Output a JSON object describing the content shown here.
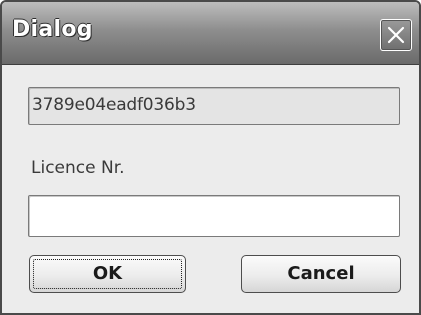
{
  "window": {
    "title": "Dialog"
  },
  "titlebar": {
    "close_icon": "close-x-icon"
  },
  "code_field": {
    "value": "3789e04eadf036b3"
  },
  "licence": {
    "label": "Licence Nr.",
    "value": "",
    "placeholder": ""
  },
  "buttons": {
    "ok_label": "OK",
    "cancel_label": "Cancel"
  },
  "colors": {
    "titlebar_top": "#bdbdbd",
    "titlebar_bottom": "#6a6a6a",
    "window_bg": "#ececec",
    "readonly_field_bg": "#e4e4e4",
    "input_bg": "#ffffff"
  }
}
